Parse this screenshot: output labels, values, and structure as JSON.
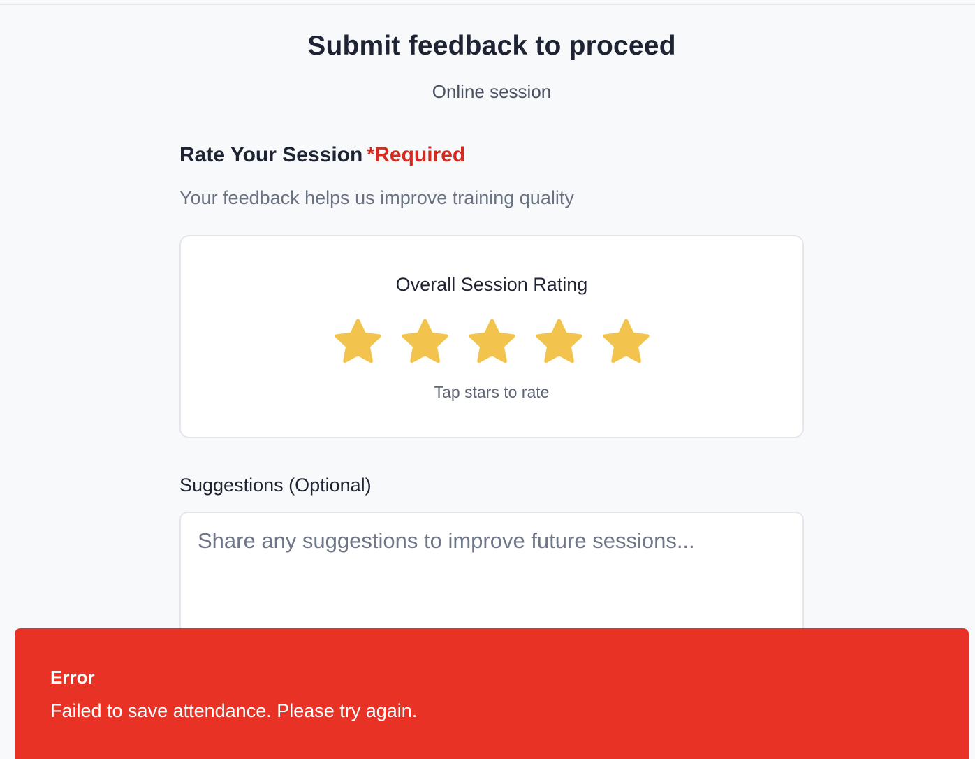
{
  "header": {
    "title": "Submit feedback to proceed",
    "subtitle": "Online session"
  },
  "rating_section": {
    "heading": "Rate Your Session",
    "required_asterisk": "*",
    "required_label": "Required",
    "help_text": "Your feedback helps us improve training quality",
    "card": {
      "title": "Overall Session Rating",
      "hint": "Tap stars to rate",
      "max_stars": 5,
      "star_icon": "star-icon",
      "star_color": "#f3c44d"
    }
  },
  "suggestions": {
    "label": "Suggestions (Optional)",
    "value": "",
    "placeholder": "Share any suggestions to improve future sessions..."
  },
  "error_toast": {
    "title": "Error",
    "message": "Failed to save attendance. Please try again.",
    "background_color": "#e83225"
  },
  "colors": {
    "required": "#d42a1f",
    "page_background": "#f8f9fb"
  }
}
